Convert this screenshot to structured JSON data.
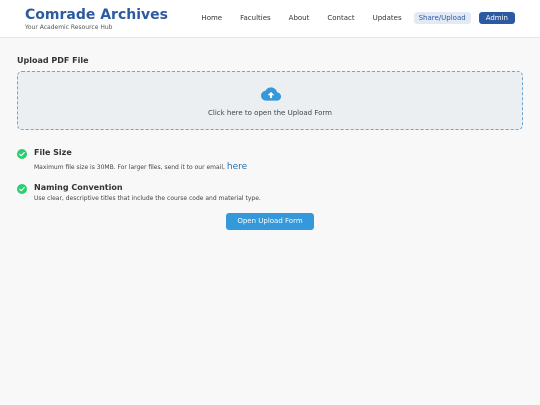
{
  "header": {
    "title": "Comrade Archives",
    "subtitle": "Your Academic Resource Hub",
    "nav": [
      "Home",
      "Faculties",
      "About",
      "Contact",
      "Updates",
      "Share/Upload",
      "Admin"
    ]
  },
  "upload": {
    "section_title": "Upload PDF File",
    "dropzone_text": "Click here to open the Upload Form",
    "icon": "cloud-upload-icon"
  },
  "requirements": [
    {
      "title": "File Size",
      "description": "Maximum file size is 30MB. For larger files, send it to our email,",
      "link_text": "here"
    },
    {
      "title": "Naming Convention",
      "description": "Use clear, descriptive titles that include the course code and material type."
    }
  ],
  "actions": {
    "open_form_label": "Open Upload Form"
  },
  "colors": {
    "brand": "#2c5aa0",
    "accent": "#3498db",
    "success": "#2ecc71",
    "admin_bg": "#2c5aa0",
    "share_bg": "#e3eaf5"
  }
}
